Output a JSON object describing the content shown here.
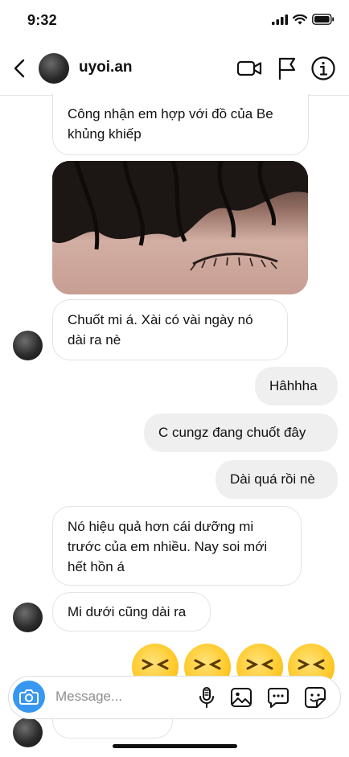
{
  "status": {
    "time": "9:32"
  },
  "header": {
    "username": "uyoi.an"
  },
  "messages": [
    {
      "side": "in",
      "text": "Công nhận em hợp với đồ của Be khủng khiếp"
    },
    {
      "side": "in",
      "text": "Chuốt mi á. Xài có vài ngày nó dài ra nè"
    },
    {
      "side": "out",
      "text": "Hâhhha"
    },
    {
      "side": "out",
      "text": "C cungz đang chuốt đây"
    },
    {
      "side": "out",
      "text": "Dài quá rồi nè"
    },
    {
      "side": "in",
      "text": "Nó hiệu quả hơn cái dưỡng mi trước của em nhiều. Nay soi mới hết hồn á"
    },
    {
      "side": "in",
      "text": "Mi dưới cũng dài ra"
    }
  ],
  "composer": {
    "placeholder": "Message..."
  },
  "colors": {
    "accent": "#3897f0",
    "outgoing_bubble": "#efefef",
    "incoming_border": "#e3e3e3"
  },
  "icons": [
    "back-icon",
    "video-call-icon",
    "flag-icon",
    "info-icon",
    "camera-icon",
    "microphone-icon",
    "gallery-icon",
    "chat-bubble-icon",
    "sticker-icon"
  ]
}
